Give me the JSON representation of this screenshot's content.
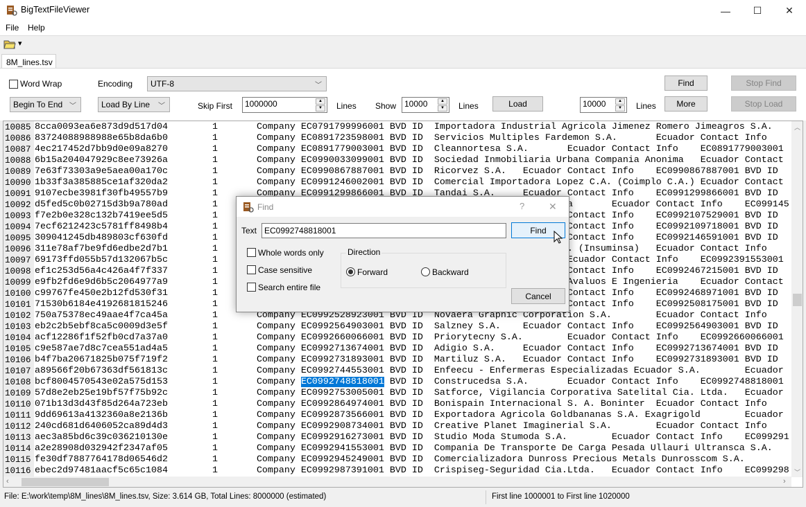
{
  "window": {
    "title": "BigTextFileViewer",
    "minimize": "—",
    "maximize": "☐",
    "close": "✕"
  },
  "menu": {
    "file": "File",
    "help": "Help"
  },
  "toolbar": {
    "open_icon": "folder-open-icon",
    "dropdown": "▾"
  },
  "tabs": [
    {
      "label": "8M_lines.tsv",
      "active": true
    }
  ],
  "controls": {
    "word_wrap_label": "Word Wrap",
    "word_wrap_checked": false,
    "encoding_label": "Encoding",
    "encoding_value": "UTF-8",
    "direction_value": "Begin To End",
    "load_mode_value": "Load By Line",
    "skip_first_label": "Skip First",
    "skip_first_value": "1000000",
    "lines_label": "Lines",
    "show_label": "Show",
    "show_value": "10000",
    "load_button": "Load",
    "more_value": "10000",
    "find_button": "Find",
    "stop_find_button": "Stop Find",
    "more_button": "More",
    "stop_load_button": "Stop Load"
  },
  "viewer": {
    "rows": [
      {
        "num": "10085",
        "text": "8cca0093ea6e873d9d517d04\t1\tCompany EC0791799996001 BVD ID\tImportadora Industrial Agricola Jimenez Romero Jimeagros S.A."
      },
      {
        "num": "10086",
        "text": "83724088988988e65b8da6b0\t1\tCompany EC0891723598001 BVD ID\tServicios Multiples Fardemon S.A.\tEcuador Contact Info"
      },
      {
        "num": "10087",
        "text": "4ec217452d7bb9d0e09a8270\t1\tCompany EC0891779003001 BVD ID\tCleannortesa S.A.\tEcuador Contact Info\tEC0891779003001"
      },
      {
        "num": "10088",
        "text": "6b15a204047929c8ee73926a\t1\tCompany EC0990033099001 BVD ID\tSociedad Inmobiliaria Urbana Compania Anonima\tEcuador Contact"
      },
      {
        "num": "10089",
        "text": "7e63f73303a9e5aea00a170c\t1\tCompany EC0990867887001 BVD ID\tRicorvez S.A.\tEcuador Contact Info\tEC0990867887001 BVD ID"
      },
      {
        "num": "10090",
        "text": "1b33f3a385885ce1af320da2\t1\tCompany EC0991246002001 BVD ID\tComercial Importadora Lopez C.A. (Coimplo C.A.)\tEcuador Contact"
      },
      {
        "num": "10091",
        "text": "9107ecbe3981f30fb49557b9\t1\tCompany EC0991299866001 BVD ID\tTandai S.A.\tEcuador Contact Info\tEC0991299866001 BVD ID"
      },
      {
        "num": "10092",
        "text": "d5fed5c0b02715d3b9a780ad\t1\t                                                       sa\tEcuador Contact Info\tEC099145"
      },
      {
        "num": "10093",
        "text": "f7e2b0e328c132b7419ee5d5\t1\t                                                        Contact Info\tEC0992107529001 BVD ID"
      },
      {
        "num": "10094",
        "text": "7ecf6212423c5781ff8498b4\t1\t                                                        Contact Info\tEC0992109718001 BVD ID"
      },
      {
        "num": "10095",
        "text": "309041245db489803cf630fd\t1\t                                                        Contact Info\tEC0992146591001 BVD ID"
      },
      {
        "num": "10096",
        "text": "311e78af7be9fd6edbe2d7b1\t1\t                                                        . (Insuminsa)\tEcuador Contact Info"
      },
      {
        "num": "10097",
        "text": "69173ffd055b57d132067b5c\t1\t                                                        Ecuador Contact Info\tEC0992391553001"
      },
      {
        "num": "10098",
        "text": "ef1c253d56a4c426a4f7f337\t1\t                                                        Contact Info\tEC0992467215001 BVD ID"
      },
      {
        "num": "10099",
        "text": "e9fb2fd6e9d6b5c2064977a9\t1\t                                                        Avaluos E Ingenieria\tEcuador Contact"
      },
      {
        "num": "10100",
        "text": "c99767fe450e2b12fd530f31\t1\t                                                        Contact Info\tEC0992468971001 BVD ID"
      },
      {
        "num": "10101",
        "text": "71530b6184e4192681815246\t1\t                                                        Contact Info\tEC0992508175001 BVD ID"
      },
      {
        "num": "10102",
        "text": "750a75378ec49aae4f7ca45a\t1\tCompany EC0992528923001 BVD ID\tNovaera Graphic Corporation S.A.\tEcuador Contact Info"
      },
      {
        "num": "10103",
        "text": "eb2c2b5ebf8ca5c0009d3e5f\t1\tCompany EC0992564903001 BVD ID\tSalzney S.A.\tEcuador Contact Info\tEC0992564903001 BVD ID"
      },
      {
        "num": "10104",
        "text": "acf12286f1f52fb0cd7a37a0\t1\tCompany EC0992660066001 BVD ID\tPriorytecny S.A.\tEcuador Contact Info\tEC0992660066001"
      },
      {
        "num": "10105",
        "text": "c9e587ae7d8c7cea551ad4a5\t1\tCompany EC0992713674001 BVD ID\tAdigio S.A.\tEcuador Contact Info\tEC0992713674001 BVD ID"
      },
      {
        "num": "10106",
        "text": "b4f7ba20671825b075f719f2\t1\tCompany EC0992731893001 BVD ID\tMartiluz S.A.\tEcuador Contact Info\tEC0992731893001 BVD ID"
      },
      {
        "num": "10107",
        "text": "a89566f20b67363df561813c\t1\tCompany EC0992744553001 BVD ID\tEnfeecu - Enfermeras Especializadas Ecuador S.A.\tEcuador"
      },
      {
        "num": "10108",
        "pre": "bcf8004570543e02a575d153\t1\tCompany ",
        "match": "EC0992748818001",
        "post": " BVD ID\tConstrucedsa S.A.\tEcuador Contact Info\tEC0992748818001"
      },
      {
        "num": "10109",
        "text": "57d8e2eb25e19bf57f75b92c\t1\tCompany EC0992753005001 BVD ID\tSatforce, Vigilancia Corporativa Satelital Cia. Ltda.\tEcuador"
      },
      {
        "num": "10110",
        "text": "071b13d3d43f85d264a723eb\t1\tCompany EC0992864974001 BVD ID\tBonispain Internacional S. A. Boninter\tEcuador Contact Info"
      },
      {
        "num": "10111",
        "text": "9dd69613a4132360a8e2136b\t1\tCompany EC0992873566001 BVD ID\tExportadora Agricola Goldbananas S.A. Exagrigold\tEcuador"
      },
      {
        "num": "10112",
        "text": "240cd681d6406052ca89d4d3\t1\tCompany EC0992908734001 BVD ID\tCreative Planet Imaginerial S.A.\tEcuador Contact Info"
      },
      {
        "num": "10113",
        "text": "aec3a85bd6c39c036210130e\t1\tCompany EC0992916273001 BVD ID\tStudio Moda Stumoda S.A.\tEcuador Contact Info\tEC099291"
      },
      {
        "num": "10114",
        "text": "a2e28908d032942f2347af05\t1\tCompany EC0992941553001 BVD ID\tCompania De Transporte De Carga Pesada Ullauri Ultransca S.A."
      },
      {
        "num": "10115",
        "text": "fe30df7887764178d06546d2\t1\tCompany EC0992945249001 BVD ID\tComercializadora Dunross Precious Metals Dunrosscom S.A."
      },
      {
        "num": "10116",
        "text": "ebec2d97481aacf5c65c1084\t1\tCompany EC0992987391001 BVD ID\tCrispiseg-Seguridad Cia.Ltda.\tEcuador Contact Info\tEC099298"
      }
    ],
    "highlight_color": "#0078d7"
  },
  "find_dialog": {
    "title": "Find",
    "help": "?",
    "close": "✕",
    "text_label": "Text",
    "text_value": "EC0992748818001",
    "find_button": "Find",
    "cancel_button": "Cancel",
    "whole_words_label": "Whole words only",
    "whole_words_checked": false,
    "case_sensitive_label": "Case sensitive",
    "case_sensitive_checked": false,
    "search_entire_label": "Search entire file",
    "search_entire_checked": false,
    "direction_label": "Direction",
    "forward_label": "Forward",
    "backward_label": "Backward",
    "direction_selected": "Forward"
  },
  "status": {
    "file_info": "File: E:\\work\\temp\\8M_lines\\8M_lines.tsv, Size:   3.614 GB, Total Lines: 8000000 (estimated)",
    "range_info": "First line 1000001 to First line 1020000"
  }
}
